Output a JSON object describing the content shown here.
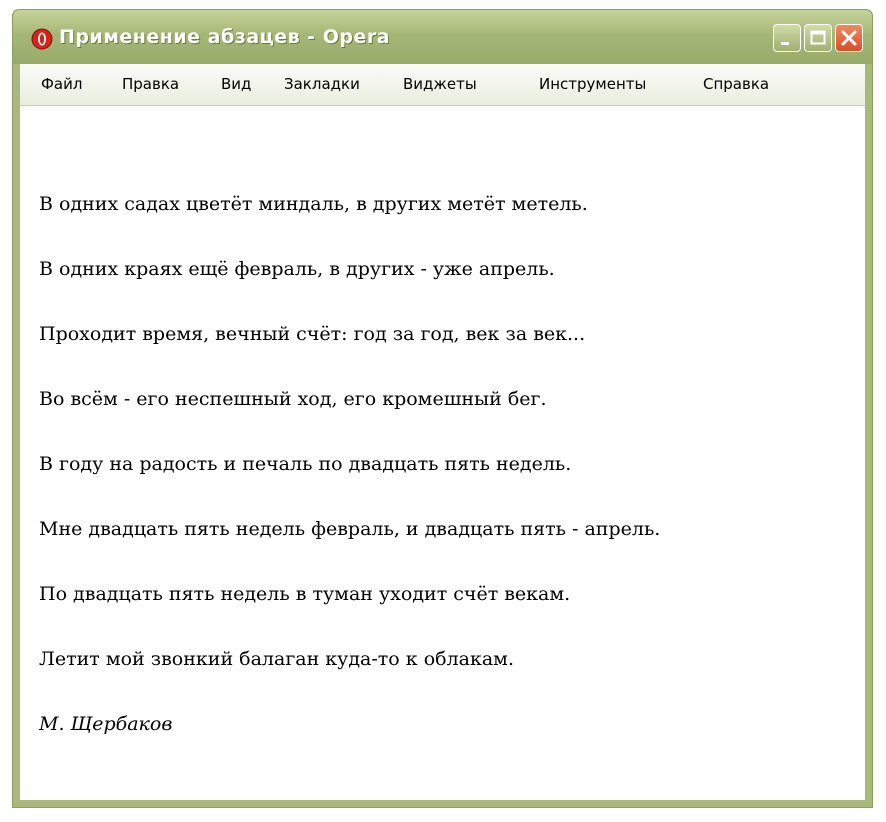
{
  "window": {
    "title": "Применение абзацев - Opera"
  },
  "menu": [
    "Файл",
    "Правка",
    "Вид",
    "Закладки",
    "Виджеты",
    "Инструменты",
    "Справка"
  ],
  "content": {
    "lines": [
      "В одних садах цветёт миндаль, в других метёт метель.",
      "В одних краях ещё февраль, в других - уже апрель.",
      "Проходит время, вечный счёт: год за год, век за век...",
      "Во всём - его неспешный ход, его кромешный бег.",
      "В году на радость и печаль по двадцать пять недель.",
      "Мне двадцать пять недель февраль, и двадцать пять - апрель.",
      "По двадцать пять недель в туман уходит счёт векам.",
      "Летит мой звонкий балаган куда-то к облакам."
    ],
    "author": "М. Щербаков"
  }
}
